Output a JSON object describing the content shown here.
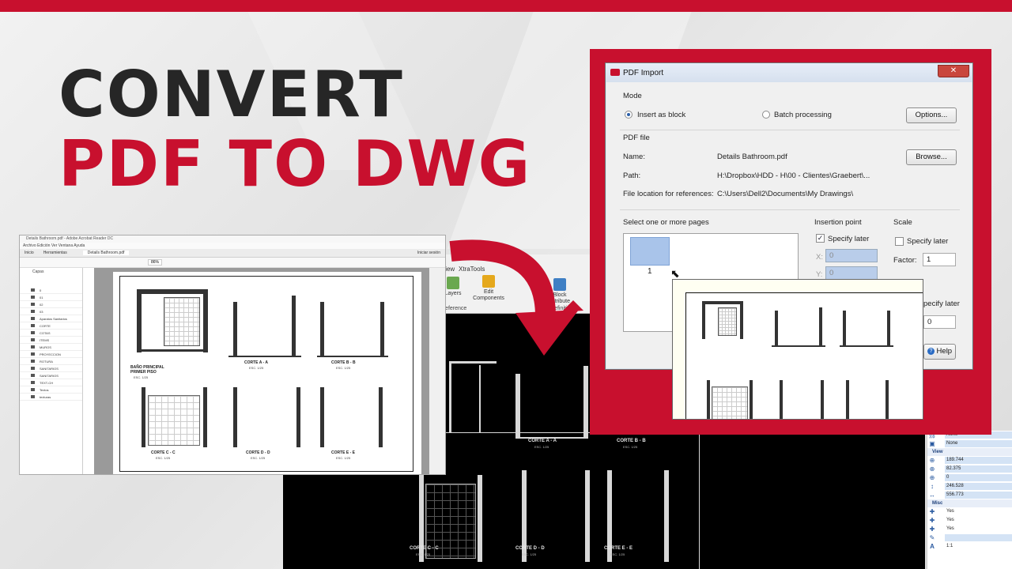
{
  "headline": {
    "line1": "CONVERT",
    "line2": "PDF TO DWG"
  },
  "colors": {
    "accent": "#c8102e",
    "dark": "#262626"
  },
  "pdf_viewer": {
    "title": "Details Bathroom.pdf - Adobe Acrobat Reader DC",
    "menu": "Archivo  Edición  Ver  Ventana  Ayuda",
    "tabs": [
      "Inicio",
      "Herramientas",
      "Details Bathroom.pdf"
    ],
    "sign_in": "Iniciar sesión",
    "zoom": "86%",
    "layers_header": "Capas",
    "layers": [
      "0",
      "01",
      "02",
      "03",
      "Aparatos Sanitarios",
      "CORTE",
      "COTAS",
      "ITEMS",
      "MUROS",
      "PROYECCION",
      "ROTURA",
      "SANITARIOS",
      "SANITARIOS",
      "TEXT-CH",
      "Textos",
      "texturas"
    ],
    "captions": [
      {
        "title": "BAÑO PRINCIPAL",
        "sub": "PRIMER PISO",
        "scale": "ESC. 1/25"
      },
      {
        "title": "CORTE A - A",
        "scale": "ESC. 1/25"
      },
      {
        "title": "CORTE B - B",
        "scale": "ESC. 1/25"
      },
      {
        "title": "CORTE C - C",
        "scale": "ESC. 1/25"
      },
      {
        "title": "CORTE D - D",
        "scale": "ESC. 1/25"
      },
      {
        "title": "CORTE E - E",
        "scale": "ESC. 1/25"
      }
    ]
  },
  "cad": {
    "tabs": [
      "View",
      "XtraTools"
    ],
    "buttons": [
      {
        "label": "Layers"
      },
      {
        "label": "Edit Components"
      },
      {
        "label": "Block Attribute"
      }
    ],
    "groups": [
      "Reference",
      "Definition"
    ],
    "captions": [
      {
        "title": "CORTE A - A",
        "scale": "ESC. 1/25"
      },
      {
        "title": "CORTE B - B",
        "scale": "ESC. 1/25"
      },
      {
        "title": "CORTE C - C",
        "scale": "ESC. 1/25"
      },
      {
        "title": "CORTE D - D",
        "scale": "ESC. 1/25"
      },
      {
        "title": "CORTE E - E",
        "scale": "ESC. 1/25"
      }
    ]
  },
  "properties": {
    "rows_top": [
      {
        "icon": "link-icon",
        "value": "None"
      },
      {
        "icon": "image-icon",
        "value": "None"
      }
    ],
    "view_header": "View",
    "view_rows": [
      "189.744",
      "82.375",
      "0",
      "246.528",
      "556.773"
    ],
    "misc_header": "Misc",
    "misc_rows": [
      "Yes",
      "Yes",
      "Yes",
      "",
      "1:1"
    ]
  },
  "dialog": {
    "title": "PDF Import",
    "mode_label": "Mode",
    "insert_as_block": "Insert as block",
    "batch_processing": "Batch processing",
    "options_button": "Options...",
    "pdf_file_label": "PDF file",
    "name_label": "Name:",
    "name_value": "Details Bathroom.pdf",
    "browse_button": "Browse...",
    "path_label": "Path:",
    "path_value": "H:\\Dropbox\\HDD - H\\00 - Clientes\\Graebert\\...",
    "file_location_label": "File location for references:",
    "file_location_value": "C:\\Users\\Dell2\\Documents\\My Drawings\\",
    "select_pages_label": "Select one or more pages",
    "page_number": "1",
    "insertion_point_label": "Insertion point",
    "specify_later": "Specify later",
    "x_label": "X:",
    "x_value": "0",
    "y_label": "Y:",
    "y_value": "0",
    "scale_label": "Scale",
    "scale_specify_later": "Specify later",
    "factor_label": "Factor:",
    "factor_value": "1",
    "rotation_specify_later": "pecify later",
    "rotation_value": "0",
    "help_button": "Help"
  }
}
